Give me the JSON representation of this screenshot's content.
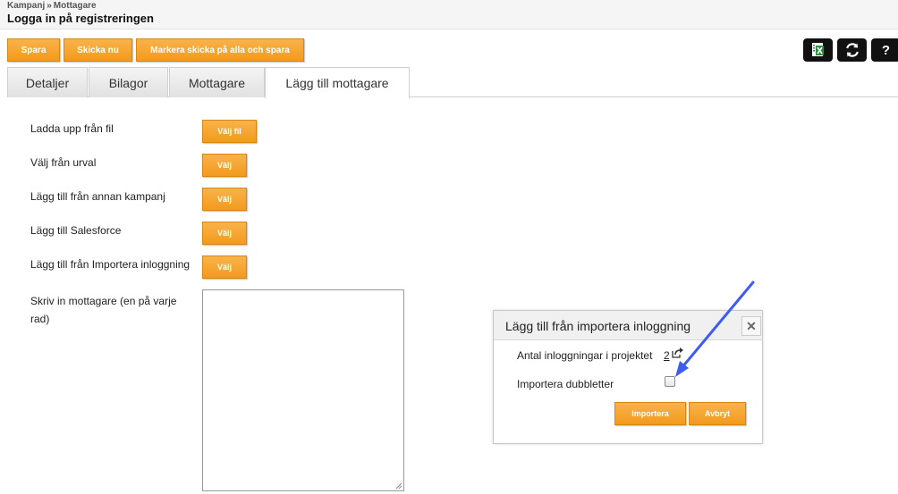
{
  "header": {
    "breadcrumb": [
      "Kampanj",
      "Mottagare"
    ],
    "breadcrumb_separator": "»",
    "title": "Logga in på registreringen"
  },
  "toolbar": {
    "save_label": "Spara",
    "send_now_label": "Skicka nu",
    "mark_send_all_label": "Markera skicka på alla och spara",
    "export_excel_icon": "excel-export-icon",
    "refresh_icon": "refresh-icon",
    "help_label": "?"
  },
  "tabs": [
    {
      "label": "Detaljer",
      "active": false
    },
    {
      "label": "Bilagor",
      "active": false
    },
    {
      "label": "Mottagare",
      "active": false
    },
    {
      "label": "Lägg till mottagare",
      "active": true
    }
  ],
  "form": {
    "upload_label": "Ladda upp från fil",
    "upload_button": "Välj fil",
    "selection_label": "Välj från urval",
    "selection_button": "Välj",
    "other_campaign_label": "Lägg till från annan kampanj",
    "other_campaign_button": "Välj",
    "salesforce_label": "Lägg till Salesforce",
    "salesforce_button": "Välj",
    "import_login_label": "Lägg till från Importera inloggning",
    "import_login_button": "Välj",
    "manual_label": "Skriv in mottagare (en på varje rad)",
    "manual_value": ""
  },
  "dialog": {
    "title": "Lägg till från importera inloggning",
    "close_label": "✕",
    "count_label": "Antal inloggningar i projektet",
    "count_value": "2",
    "duplicates_label": "Importera dubbletter",
    "duplicates_checked": false,
    "import_button": "Importera",
    "cancel_button": "Avbryt"
  },
  "colors": {
    "button_orange": "#f29a1e",
    "annotation_arrow": "#3d5cf0"
  }
}
